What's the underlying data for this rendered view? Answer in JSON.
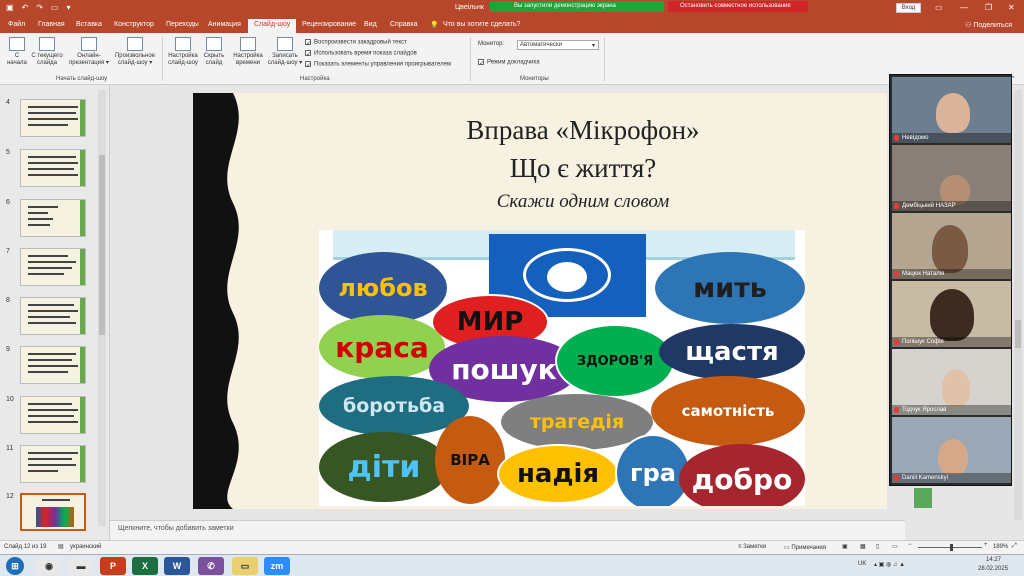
{
  "title_bar": {
    "doc_title": "Цвеільнк",
    "banner_green": "Вы запустили демонстрацию экрана",
    "banner_red": "Остановить совместное использование",
    "signin": "Вход"
  },
  "tabs": [
    "Файл",
    "Главная",
    "Вставка",
    "Конструктор",
    "Переходы",
    "Анимация",
    "Слайд-шоу",
    "Рецензирование",
    "Вид",
    "Справка"
  ],
  "tell_me": "Что вы хотите сделать?",
  "share": "Поделиться",
  "ribbon": {
    "start_group_label": "Начать слайд-шоу",
    "buttons": [
      {
        "l1": "С",
        "l2": "начала"
      },
      {
        "l1": "С текущего",
        "l2": "слайда"
      },
      {
        "l1": "Онлайн-",
        "l2": "презентация ▾"
      },
      {
        "l1": "Произвольное",
        "l2": "слайд-шоу ▾"
      },
      {
        "l1": "Настройка",
        "l2": "слайд-шоу"
      },
      {
        "l1": "Скрыть",
        "l2": "слайд"
      },
      {
        "l1": "Настройка",
        "l2": "времени"
      },
      {
        "l1": "Записать",
        "l2": "слайд-шоу ▾"
      }
    ],
    "checkboxes": [
      "Воспроизвести закадровый текст",
      "Использовать время показа слайдов",
      "Показать элементы управления проигрывателем"
    ],
    "setup_group_label": "Настройка",
    "monitor_label": "Монитор:",
    "monitor_value": "Автоматически",
    "presenter_label": "Режим докладчика",
    "monitors_group_label": "Мониторы"
  },
  "slides": [
    "4",
    "5",
    "6",
    "7",
    "8",
    "9",
    "10",
    "11",
    "12"
  ],
  "slide": {
    "title_line1": "Вправа «Мікрофон»",
    "title_line2": "Що є життя?",
    "subtitle": "Скажи одним словом",
    "words": [
      "любов",
      "МИР",
      "мить",
      "краса",
      "пошук",
      "ЗДОРОВ'Я",
      "щастя",
      "боротьба",
      "трагедія",
      "самотність",
      "діти",
      "ВІРА",
      "надія",
      "гра",
      "добро"
    ]
  },
  "notes_placeholder": "Щелкните, чтобы добавить заметки",
  "status": {
    "slide_info": "Слайд 12 из 19",
    "language": "украинский",
    "notes_btn": "Заметки",
    "comments_btn": "Примечания",
    "zoom": "189%"
  },
  "participants": [
    "Невідомо",
    "Дембіцький НАЗАР",
    "Мацюк Наталія",
    "Полішук Софія",
    "Тодчук Ярослав",
    "Daniil Kamenskyi"
  ],
  "taskbar": {
    "lang": "UK",
    "time": "14:27",
    "date": "28.02.2025"
  },
  "colors": {
    "accent": "#b7472a",
    "green_banner": "#22a33a",
    "red_banner": "#d3242a"
  }
}
